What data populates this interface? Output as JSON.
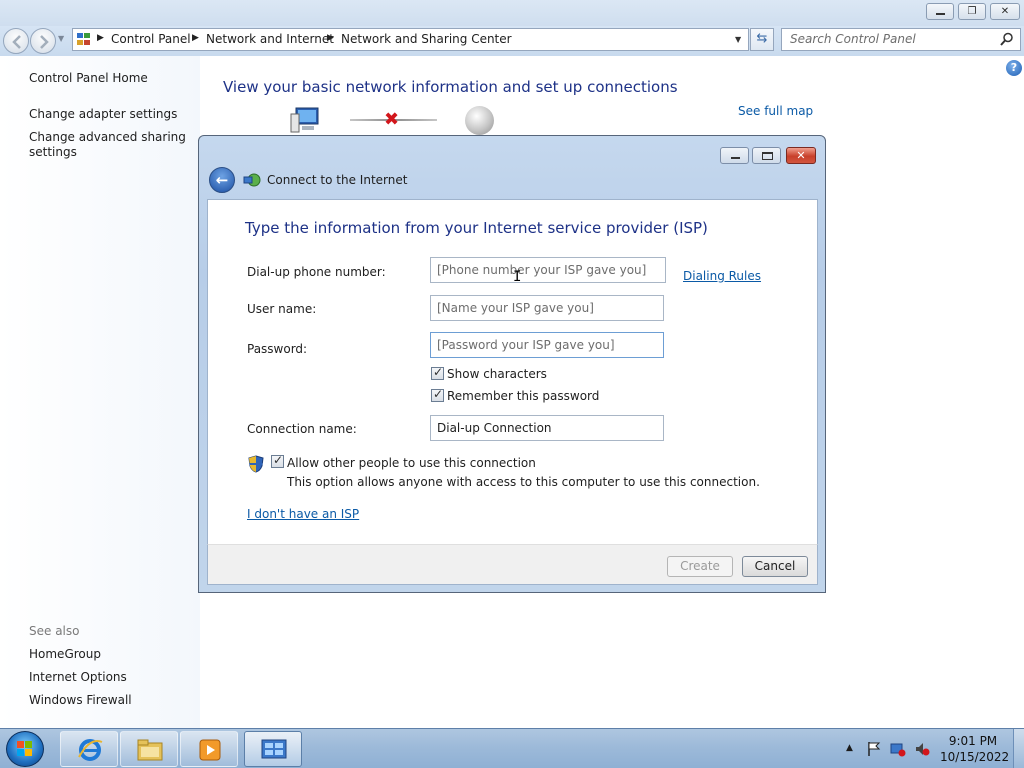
{
  "window": {
    "breadcrumbs": [
      "Control Panel",
      "Network and Internet",
      "Network and Sharing Center"
    ],
    "search_placeholder": "Search Control Panel"
  },
  "sidebar": {
    "items": [
      {
        "label": "Control Panel Home"
      },
      {
        "label": "Change adapter settings"
      },
      {
        "label": "Change advanced sharing"
      },
      {
        "label": "settings"
      }
    ],
    "see_also_heading": "See also",
    "see_also": [
      {
        "label": "HomeGroup"
      },
      {
        "label": "Internet Options"
      },
      {
        "label": "Windows Firewall"
      }
    ]
  },
  "main": {
    "title": "View your basic network information and set up connections",
    "see_full_map": "See full map"
  },
  "dialog": {
    "title": "Connect to the Internet",
    "heading": "Type the information from your Internet service provider (ISP)",
    "fields": {
      "phone_label": "Dial-up phone number:",
      "phone_placeholder": "[Phone number your ISP gave you]",
      "dialing_rules": "Dialing Rules",
      "user_label": "User name:",
      "user_placeholder": "[Name your ISP gave you]",
      "password_label": "Password:",
      "password_placeholder": "[Password your ISP gave you]",
      "show_characters": "Show characters",
      "remember_password": "Remember this password",
      "connection_label": "Connection name:",
      "connection_value": "Dial-up Connection",
      "allow_others": "Allow other people to use this connection",
      "allow_others_desc": "This option allows anyone with access to this computer to use this connection."
    },
    "no_isp_link": "I don't have an ISP",
    "buttons": {
      "create": "Create",
      "cancel": "Cancel"
    }
  },
  "taskbar": {
    "clock_time": "9:01 PM",
    "clock_date": "10/15/2022"
  },
  "colors": {
    "heading_blue": "#1e3287",
    "link_blue": "#0b5aa6",
    "error_red": "#d2161b"
  },
  "icons": [
    "back-icon",
    "forward-icon",
    "control-panel-icon",
    "refresh-icon",
    "search-icon",
    "help-icon",
    "computer-icon",
    "globe-icon",
    "shield-icon",
    "windows-flag-icon",
    "internet-explorer-icon",
    "folder-icon",
    "media-player-icon",
    "network-icon"
  ]
}
